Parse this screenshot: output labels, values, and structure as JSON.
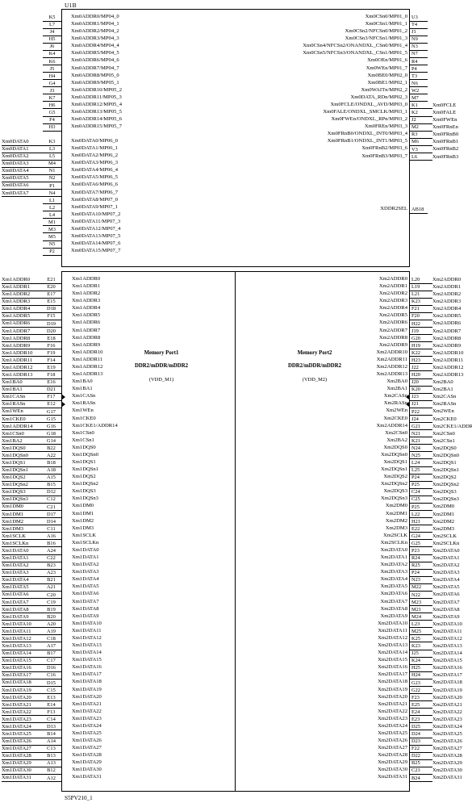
{
  "sheet": {
    "title_top": "U1B",
    "title_bottom": "S5PV210_1"
  },
  "center_labels": {
    "port1_name": "Memory Port1",
    "port1_type": "DDR2/mDDR/mDDR2",
    "port1_rail": "(VDD_M1)",
    "port2_name": "Memory Port2",
    "port2_type": "DDR2/mDDR/mDDR2",
    "port2_rail": "(VDD_M2)"
  },
  "top_block": {
    "left_addr": [
      {
        "pin": "K5",
        "name": "Xm0ADDR0/MP04_0",
        "net": ""
      },
      {
        "pin": "L7",
        "name": "Xm0ADDR1/MP04_1",
        "net": ""
      },
      {
        "pin": "J4",
        "name": "Xm0ADDR2/MP04_2",
        "net": ""
      },
      {
        "pin": "H5",
        "name": "Xm0ADDR3/MP04_3",
        "net": ""
      },
      {
        "pin": "J6",
        "name": "Xm0ADDR4/MP04_4",
        "net": ""
      },
      {
        "pin": "K4",
        "name": "Xm0ADDR5/MP04_5",
        "net": ""
      },
      {
        "pin": "K6",
        "name": "Xm0ADDR6/MP04_6",
        "net": ""
      },
      {
        "pin": "J5",
        "name": "Xm0ADDR7/MP04_7",
        "net": ""
      },
      {
        "pin": "H4",
        "name": "Xm0ADDR8/MP05_0",
        "net": ""
      },
      {
        "pin": "G4",
        "name": "Xm0ADDR9/MP05_1",
        "net": ""
      },
      {
        "pin": "J3",
        "name": "Xm0ADDR10/MP05_2",
        "net": ""
      },
      {
        "pin": "K7",
        "name": "Xm0ADDR11/MP05_3",
        "net": ""
      },
      {
        "pin": "H6",
        "name": "Xm0ADDR12/MP05_4",
        "net": ""
      },
      {
        "pin": "G5",
        "name": "Xm0ADDR13/MP05_5",
        "net": ""
      },
      {
        "pin": "F4",
        "name": "Xm0ADDR14/MP05_6",
        "net": ""
      },
      {
        "pin": "H3",
        "name": "Xm0ADDR15/MP05_7",
        "net": ""
      }
    ],
    "left_data": [
      {
        "pin": "K3",
        "name": "Xm0DATA0/MP06_0",
        "net": "Xm0DATA0"
      },
      {
        "pin": "L3",
        "name": "Xm0DATA1/MP06_1",
        "net": "Xm0DATA1"
      },
      {
        "pin": "L5",
        "name": "Xm0DATA2/MP06_2",
        "net": "Xm0DATA2"
      },
      {
        "pin": "M4",
        "name": "Xm0DATA3/MP06_3",
        "net": "Xm0DATA3"
      },
      {
        "pin": "N1",
        "name": "Xm0DATA4/MP06_4",
        "net": "Xm0DATA4"
      },
      {
        "pin": "N2",
        "name": "Xm0DATA5/MP06_5",
        "net": "Xm0DATA5"
      },
      {
        "pin": "P1",
        "name": "Xm0DATA6/MP06_6",
        "net": "Xm0DATA6"
      },
      {
        "pin": "N4",
        "name": "Xm0DATA7/MP06_7",
        "net": "Xm0DATA7"
      },
      {
        "pin": "L1",
        "name": "Xm0DATA8/MP07_0",
        "net": ""
      },
      {
        "pin": "L2",
        "name": "Xm0DATA9/MP07_1",
        "net": ""
      },
      {
        "pin": "L4",
        "name": "Xm0DATA10/MP07_2",
        "net": ""
      },
      {
        "pin": "M1",
        "name": "Xm0DATA11/MP07_3",
        "net": ""
      },
      {
        "pin": "M3",
        "name": "Xm0DATA12/MP07_4",
        "net": ""
      },
      {
        "pin": "M5",
        "name": "Xm0DATA13/MP07_5",
        "net": ""
      },
      {
        "pin": "N5",
        "name": "Xm0DATA14/MP07_6",
        "net": ""
      },
      {
        "pin": "P2",
        "name": "Xm0DATA15/MP07_7",
        "net": ""
      }
    ],
    "right_ctrl": [
      {
        "pin": "U3",
        "name": "Xm0CSn0/MP01_0",
        "net": ""
      },
      {
        "pin": "T4",
        "name": "Xm0CSn1/MP01_1",
        "net": ""
      },
      {
        "pin": "J1",
        "name": "Xm0CSn2/NFCSn0/MP01_2",
        "net": ""
      },
      {
        "pin": "N9",
        "name": "Xm0CSn3/NFCSn1/MP01_3",
        "net": ""
      },
      {
        "pin": "N3",
        "name": "Xm0CSn4/NFCSn2/ONANDXL_CSn0/MP01_4",
        "net": ""
      },
      {
        "pin": "N7",
        "name": "Xm0CSn5/NFCSn3/ONANDXL_CSn1/MP01_5",
        "net": ""
      },
      {
        "pin": "R4",
        "name": "Xm0OEn/MP01_6",
        "net": ""
      },
      {
        "pin": "P4",
        "name": "Xm0WEn/MP01_7",
        "net": ""
      },
      {
        "pin": "T3",
        "name": "Xm0BE0/MP02_0",
        "net": ""
      },
      {
        "pin": "N6",
        "name": "Xm0BE1/MP02_1",
        "net": ""
      },
      {
        "pin": "W2",
        "name": "Xm0WAITn/MP02_2",
        "net": ""
      },
      {
        "pin": "M7",
        "name": "Xm0DATA_RDn/MP02_3",
        "net": ""
      },
      {
        "pin": "K1",
        "name": "Xm0FCLE/ONDXL_AVD/MP03_0",
        "net": "Xm0FCLE"
      },
      {
        "pin": "K2",
        "name": "Xm0FALE/ONDXL_SMCLK/MP03_1",
        "net": "Xm0FALE"
      },
      {
        "pin": "J2",
        "name": "Xm0FWEn/ONDXL_RPn/MP03_2",
        "net": "Xm0FWEn"
      },
      {
        "pin": "M2",
        "name": "Xm0FREn/MP03_3",
        "net": "Xm0FRnEn"
      },
      {
        "pin": "R3",
        "name": "Xm0FRnB0/ONDXL_INT0/MP03_4",
        "net": "Xm0FRnB0"
      },
      {
        "pin": "M6",
        "name": "Xm0FRnB1/ONDXL_INT1/MP03_5",
        "net": "Xm0FRnB1"
      },
      {
        "pin": "V3",
        "name": "Xm0FRnB2/MP03_6",
        "net": "Xm0FRnB2"
      },
      {
        "pin": "L6",
        "name": "Xm0FRnB3/MP03_7",
        "net": "Xm0FRnB3"
      }
    ],
    "right_misc": [
      {
        "pin": "AB18",
        "name": "XDDR2SEL",
        "net": ""
      }
    ]
  },
  "mem_port1": {
    "ctrl": [
      {
        "pin": "E21",
        "name": "Xm1ADDR0",
        "net": "Xm1ADDR0"
      },
      {
        "pin": "E20",
        "name": "Xm1ADDR1",
        "net": "Xm1ADDR1"
      },
      {
        "pin": "E17",
        "name": "Xm1ADDR2",
        "net": "Xm1ADDR2"
      },
      {
        "pin": "E15",
        "name": "Xm1ADDR3",
        "net": "Xm1ADDR3"
      },
      {
        "pin": "D18",
        "name": "Xm1ADDR4",
        "net": "Xm1ADDR4"
      },
      {
        "pin": "F15",
        "name": "Xm1ADDR5",
        "net": "Xm1ADDR5"
      },
      {
        "pin": "D19",
        "name": "Xm1ADDR6",
        "net": "Xm1ADDR6"
      },
      {
        "pin": "D20",
        "name": "Xm1ADDR7",
        "net": "Xm1ADDR7"
      },
      {
        "pin": "E18",
        "name": "Xm1ADDR8",
        "net": "Xm1ADDR8"
      },
      {
        "pin": "F16",
        "name": "Xm1ADDR9",
        "net": "Xm1ADDR9"
      },
      {
        "pin": "F19",
        "name": "Xm1ADDR10",
        "net": "Xm1ADDR10"
      },
      {
        "pin": "F14",
        "name": "Xm1ADDR11",
        "net": "Xm1ADDR11"
      },
      {
        "pin": "E19",
        "name": "Xm1ADDR12",
        "net": "Xm1ADDR12"
      },
      {
        "pin": "F18",
        "name": "Xm1ADDR13",
        "net": "Xm1ADDR13"
      },
      {
        "pin": "E16",
        "name": "Xm1BA0",
        "net": "Xm1BA0"
      },
      {
        "pin": "D21",
        "name": "Xm1BA1",
        "net": "Xm1BA1"
      },
      {
        "pin": "F17",
        "name": "Xm1CASn",
        "net": "Xm1CASn"
      },
      {
        "pin": "E12",
        "name": "Xm1RASn",
        "net": "Xm1RASn"
      },
      {
        "pin": "G17",
        "name": "Xm1WEn",
        "net": "Xm1WEn"
      },
      {
        "pin": "G15",
        "name": "Xm1CKE0",
        "net": "Xm1CKE0"
      },
      {
        "pin": "G16",
        "name": "Xm1CKE1/ADDR14",
        "net": "Xm1ADDR14"
      },
      {
        "pin": "G18",
        "name": "Xm1CSn0",
        "net": "Xm1CSn0"
      },
      {
        "pin": "G14",
        "name": "Xm1CSn1",
        "net": "Xm1BA2"
      },
      {
        "pin": "B22",
        "name": "Xm1DQS0",
        "net": "Xm1DQS0"
      },
      {
        "pin": "A22",
        "name": "Xm1DQSn0",
        "net": "Xm1DQSn0"
      },
      {
        "pin": "B18",
        "name": "Xm1DQS1",
        "net": "Xm1DQS1"
      },
      {
        "pin": "A18",
        "name": "Xm1DQSn1",
        "net": "Xm1DQSn1"
      },
      {
        "pin": "A15",
        "name": "Xm1DQS2",
        "net": "Xm1DQS2"
      },
      {
        "pin": "B15",
        "name": "Xm1DQSn2",
        "net": "Xm1DQSn2"
      },
      {
        "pin": "D12",
        "name": "Xm1DQS3",
        "net": "Xm1DQS3"
      },
      {
        "pin": "C12",
        "name": "Xm1DQSn3",
        "net": "Xm1DQSn3"
      },
      {
        "pin": "C21",
        "name": "Xm1DM0",
        "net": "Xm1DM0"
      },
      {
        "pin": "D17",
        "name": "Xm1DM1",
        "net": "Xm1DM1"
      },
      {
        "pin": "D14",
        "name": "Xm1DM2",
        "net": "Xm1DM2"
      },
      {
        "pin": "C11",
        "name": "Xm1DM3",
        "net": "Xm1DM3"
      },
      {
        "pin": "A16",
        "name": "Xm1SCLK",
        "net": "Xm1SCLK"
      },
      {
        "pin": "B16",
        "name": "Xm1SCLKn",
        "net": "Xm1SCLKn"
      }
    ],
    "data": [
      {
        "pin": "A24",
        "name": "Xm1DATA0",
        "net": "Xm1DATA0"
      },
      {
        "pin": "C22",
        "name": "Xm1DATA1",
        "net": "Xm1DATA1"
      },
      {
        "pin": "B23",
        "name": "Xm1DATA2",
        "net": "Xm1DATA2"
      },
      {
        "pin": "A23",
        "name": "Xm1DATA3",
        "net": "Xm1DATA3"
      },
      {
        "pin": "B21",
        "name": "Xm1DATA4",
        "net": "Xm1DATA4"
      },
      {
        "pin": "A21",
        "name": "Xm1DATA5",
        "net": "Xm1DATA5"
      },
      {
        "pin": "C20",
        "name": "Xm1DATA6",
        "net": "Xm1DATA6"
      },
      {
        "pin": "C19",
        "name": "Xm1DATA7",
        "net": "Xm1DATA7"
      },
      {
        "pin": "B19",
        "name": "Xm1DATA8",
        "net": "Xm1DATA8"
      },
      {
        "pin": "B20",
        "name": "Xm1DATA9",
        "net": "Xm1DATA9"
      },
      {
        "pin": "A20",
        "name": "Xm1DATA10",
        "net": "Xm1DATA10"
      },
      {
        "pin": "A19",
        "name": "Xm1DATA11",
        "net": "Xm1DATA11"
      },
      {
        "pin": "C18",
        "name": "Xm1DATA12",
        "net": "Xm1DATA12"
      },
      {
        "pin": "A17",
        "name": "Xm1DATA13",
        "net": "Xm1DATA13"
      },
      {
        "pin": "B17",
        "name": "Xm1DATA14",
        "net": "Xm1DATA14"
      },
      {
        "pin": "C17",
        "name": "Xm1DATA15",
        "net": "Xm1DATA15"
      },
      {
        "pin": "D16",
        "name": "Xm1DATA16",
        "net": "Xm1DATA16"
      },
      {
        "pin": "C16",
        "name": "Xm1DATA17",
        "net": "Xm1DATA17"
      },
      {
        "pin": "D15",
        "name": "Xm1DATA18",
        "net": "Xm1DATA18"
      },
      {
        "pin": "C15",
        "name": "Xm1DATA19",
        "net": "Xm1DATA19"
      },
      {
        "pin": "E13",
        "name": "Xm1DATA20",
        "net": "Xm1DATA20"
      },
      {
        "pin": "E14",
        "name": "Xm1DATA21",
        "net": "Xm1DATA21"
      },
      {
        "pin": "F13",
        "name": "Xm1DATA22",
        "net": "Xm1DATA22"
      },
      {
        "pin": "C14",
        "name": "Xm1DATA23",
        "net": "Xm1DATA23"
      },
      {
        "pin": "D13",
        "name": "Xm1DATA24",
        "net": "Xm1DATA24"
      },
      {
        "pin": "B14",
        "name": "Xm1DATA25",
        "net": "Xm1DATA25"
      },
      {
        "pin": "A14",
        "name": "Xm1DATA26",
        "net": "Xm1DATA26"
      },
      {
        "pin": "C13",
        "name": "Xm1DATA27",
        "net": "Xm1DATA27"
      },
      {
        "pin": "B13",
        "name": "Xm1DATA28",
        "net": "Xm1DATA28"
      },
      {
        "pin": "A13",
        "name": "Xm1DATA29",
        "net": "Xm1DATA29"
      },
      {
        "pin": "B12",
        "name": "Xm1DATA30",
        "net": "Xm1DATA30"
      },
      {
        "pin": "A12",
        "name": "Xm1DATA31",
        "net": "Xm1DATA31"
      }
    ]
  },
  "mem_port2": {
    "ctrl": [
      {
        "pin": "L20",
        "name": "Xm2ADDR0",
        "net": "Xm2ADDR0"
      },
      {
        "pin": "L19",
        "name": "Xm2ADDR1",
        "net": "Xm2ADDR1"
      },
      {
        "pin": "L21",
        "name": "Xm2ADDR2",
        "net": "Xm2ADDR2"
      },
      {
        "pin": "K23",
        "name": "Xm2ADDR3",
        "net": "Xm2ADDR3"
      },
      {
        "pin": "F21",
        "name": "Xm2ADDR4",
        "net": "Xm2ADDR4"
      },
      {
        "pin": "F20",
        "name": "Xm2ADDR5",
        "net": "Xm2ADDR5"
      },
      {
        "pin": "H22",
        "name": "Xm2ADDR6",
        "net": "Xm2ADDR6"
      },
      {
        "pin": "J19",
        "name": "Xm2ADDR7",
        "net": "Xm2ADDR7"
      },
      {
        "pin": "G20",
        "name": "Xm2ADDR8",
        "net": "Xm2ADDR8"
      },
      {
        "pin": "H19",
        "name": "Xm2ADDR9",
        "net": "Xm2ADDR9"
      },
      {
        "pin": "K22",
        "name": "Xm2ADDR10",
        "net": "Xm2ADDR10"
      },
      {
        "pin": "H23",
        "name": "Xm2ADDR11",
        "net": "Xm2ADDR11"
      },
      {
        "pin": "J22",
        "name": "Xm2ADDR12",
        "net": "Xm2ADDR12"
      },
      {
        "pin": "H20",
        "name": "Xm2ADDR13",
        "net": "Xm2ADDR13"
      },
      {
        "pin": "J20",
        "name": "Xm2BA0",
        "net": "Xm2BA0"
      },
      {
        "pin": "K20",
        "name": "Xm2BA1",
        "net": "Xm2BA1"
      },
      {
        "pin": "J23",
        "name": "Xm2CASn",
        "net": "Xm2CASn"
      },
      {
        "pin": "J21",
        "name": "Xm2RASn",
        "net": "Xm2RASn"
      },
      {
        "pin": "P22",
        "name": "Xm2WEn",
        "net": "Xm2WEn"
      },
      {
        "pin": "J24",
        "name": "Xm2CKE0",
        "net": "Xm2CKE0"
      },
      {
        "pin": "G21",
        "name": "Xm2ADDR14",
        "net": "Xm2CKE1/ADDR14"
      },
      {
        "pin": "N21",
        "name": "Xm2CSn0",
        "net": "Xm2CSn0"
      },
      {
        "pin": "K21",
        "name": "Xm2BA2",
        "net": "Xm2CSn1"
      },
      {
        "pin": "N24",
        "name": "Xm2DQS0",
        "net": "Xm2DQS0"
      },
      {
        "pin": "N25",
        "name": "Xm2DQSn0",
        "net": "Xm2DQSn0"
      },
      {
        "pin": "L24",
        "name": "Xm2DQS1",
        "net": "Xm2DQS1"
      },
      {
        "pin": "L25",
        "name": "Xm2DQSn1",
        "net": "Xm2DQSn1"
      },
      {
        "pin": "P24",
        "name": "Xm2DQS2",
        "net": "Xm2DQS2"
      },
      {
        "pin": "P25",
        "name": "Xm2DQSn2",
        "net": "Xm2DQSn2"
      },
      {
        "pin": "C24",
        "name": "Xm2DQS3",
        "net": "Xm2DQS3"
      },
      {
        "pin": "C25",
        "name": "Xm2DQSn3",
        "net": "Xm2DQSn3"
      },
      {
        "pin": "P25",
        "name": "Xm2DM0",
        "net": "Xm2DM0"
      },
      {
        "pin": "L22",
        "name": "Xm2DM1",
        "net": "Xm2DM1"
      },
      {
        "pin": "H21",
        "name": "Xm2DM2",
        "net": "Xm2DM2"
      },
      {
        "pin": "E22",
        "name": "Xm2DM3",
        "net": "Xm2DM3"
      },
      {
        "pin": "G24",
        "name": "Xm2SCLK",
        "net": "Xm2SCLK"
      },
      {
        "pin": "G25",
        "name": "Xm2SCLKn",
        "net": "Xm2SCLKn"
      }
    ],
    "data": [
      {
        "pin": "P23",
        "name": "Xm2DATA0",
        "net": "Xm2DATA0"
      },
      {
        "pin": "R24",
        "name": "Xm2DATA1",
        "net": "Xm2DATA1"
      },
      {
        "pin": "R25",
        "name": "Xm2DATA2",
        "net": "Xm2DATA2"
      },
      {
        "pin": "P24",
        "name": "Xm2DATA3",
        "net": "Xm2DATA3"
      },
      {
        "pin": "N23",
        "name": "Xm2DATA4",
        "net": "Xm2DATA4"
      },
      {
        "pin": "M22",
        "name": "Xm2DATA5",
        "net": "Xm2DATA5"
      },
      {
        "pin": "N22",
        "name": "Xm2DATA6",
        "net": "Xm2DATA6"
      },
      {
        "pin": "M23",
        "name": "Xm2DATA7",
        "net": "Xm2DATA7"
      },
      {
        "pin": "M21",
        "name": "Xm2DATA8",
        "net": "Xm2DATA8"
      },
      {
        "pin": "M24",
        "name": "Xm2DATA9",
        "net": "Xm2DATA9"
      },
      {
        "pin": "L23",
        "name": "Xm2DATA10",
        "net": "Xm2DATA10"
      },
      {
        "pin": "M25",
        "name": "Xm2DATA11",
        "net": "Xm2DATA11"
      },
      {
        "pin": "K25",
        "name": "Xm2DATA12",
        "net": "Xm2DATA12"
      },
      {
        "pin": "K23",
        "name": "Xm2DATA13",
        "net": "Xm2DATA13"
      },
      {
        "pin": "J25",
        "name": "Xm2DATA14",
        "net": "Xm2DATA14"
      },
      {
        "pin": "K24",
        "name": "Xm2DATA15",
        "net": "Xm2DATA15"
      },
      {
        "pin": "H25",
        "name": "Xm2DATA16",
        "net": "Xm2DATA16"
      },
      {
        "pin": "H24",
        "name": "Xm2DATA17",
        "net": "Xm2DATA17"
      },
      {
        "pin": "G23",
        "name": "Xm2DATA18",
        "net": "Xm2DATA18"
      },
      {
        "pin": "G22",
        "name": "Xm2DATA19",
        "net": "Xm2DATA19"
      },
      {
        "pin": "F23",
        "name": "Xm2DATA20",
        "net": "Xm2DATA20"
      },
      {
        "pin": "E25",
        "name": "Xm2DATA21",
        "net": "Xm2DATA21"
      },
      {
        "pin": "E24",
        "name": "Xm2DATA22",
        "net": "Xm2DATA22"
      },
      {
        "pin": "E23",
        "name": "Xm2DATA23",
        "net": "Xm2DATA23"
      },
      {
        "pin": "D25",
        "name": "Xm2DATA24",
        "net": "Xm2DATA24"
      },
      {
        "pin": "D24",
        "name": "Xm2DATA25",
        "net": "Xm2DATA25"
      },
      {
        "pin": "D23",
        "name": "Xm2DATA26",
        "net": "Xm2DATA26"
      },
      {
        "pin": "F22",
        "name": "Xm2DATA27",
        "net": "Xm2DATA27"
      },
      {
        "pin": "D22",
        "name": "Xm2DATA28",
        "net": "Xm2DATA28"
      },
      {
        "pin": "B25",
        "name": "Xm2DATA29",
        "net": "Xm2DATA29"
      },
      {
        "pin": "C23",
        "name": "Xm2DATA30",
        "net": "Xm2DATA30"
      },
      {
        "pin": "B24",
        "name": "Xm2DATA31",
        "net": "Xm2DATA31"
      }
    ]
  }
}
